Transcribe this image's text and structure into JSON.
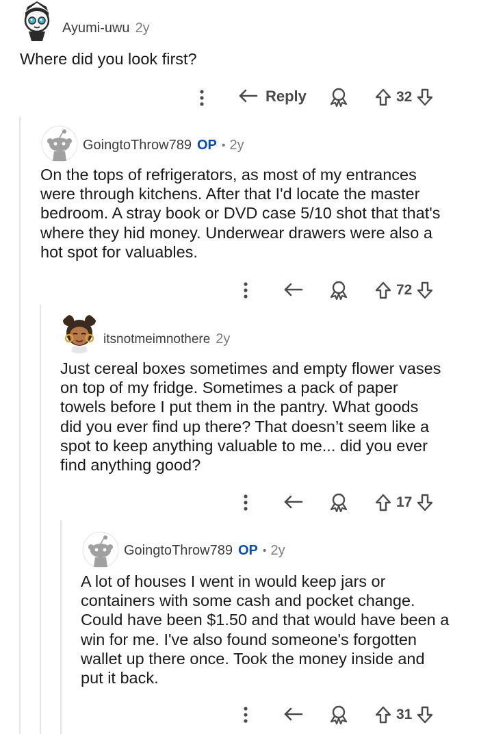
{
  "comments": [
    {
      "username": "Ayumi-uwu",
      "op": "",
      "age": "2y",
      "body": "Where did you look first?",
      "reply_label": "Reply",
      "votes": "32"
    },
    {
      "username": "GoingtoThrow789",
      "op": "OP",
      "age": "2y",
      "body": "On the tops of refrigerators, as most of my entrances\nwere through kitchens. After that I'd locate the master\nbedroom. A stray book or DVD case 5/10 shot that that's\nwhere they hid money. Underwear drawers were also a\nhot spot for valuables.",
      "votes": "72"
    },
    {
      "username": "itsnotmeimnothere",
      "op": "",
      "age": "2y",
      "body": "Just cereal boxes sometimes and empty flower vases\non top of my fridge. Sometimes a pack of paper\ntowels before I put them in the pantry. What goods\ndid you ever find up there? That doesn’t seem like a\nspot to keep anything valuable to me... did you ever\nfind anything good?",
      "votes": "17"
    },
    {
      "username": "GoingtoThrow789",
      "op": "OP",
      "age": "2y",
      "body": "A lot of houses I went in would keep jars or\ncontainers with some cash and pocket change.\nCould have been $1.50 and that would have been a\nwin for me. I've also found someone's forgotten\nwallet up there once. Took the money inside and\nput it back.",
      "votes": "31"
    }
  ],
  "icons": {
    "more": "more-options-icon",
    "reply": "reply-arrow-icon",
    "award": "award-icon",
    "upvote": "upvote-arrow-icon",
    "downvote": "downvote-arrow-icon"
  },
  "colors": {
    "op_badge": "#0a4fa8",
    "text": "#1a1a1b",
    "muted": "#7c7c7c",
    "thread_line": "#e5e5e5"
  }
}
